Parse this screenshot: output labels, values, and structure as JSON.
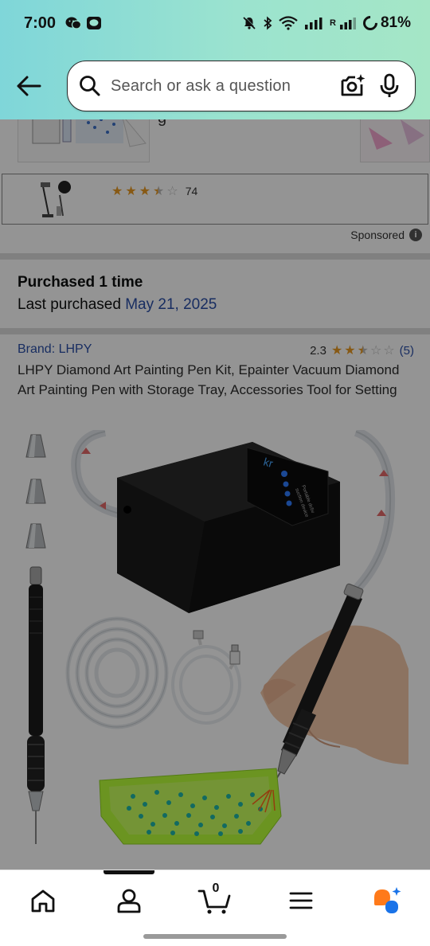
{
  "status_bar": {
    "time": "7:00",
    "battery": "81%",
    "signal_label": "R"
  },
  "search": {
    "placeholder": "Search or ask a question"
  },
  "sponsored_item": {
    "rating_count": "74",
    "stars": 3.5,
    "sponsored_label": "Sponsored"
  },
  "purchase_info": {
    "title": "Purchased 1 time",
    "last_purchased_label": "Last purchased ",
    "last_purchased_date": "May 21, 2025"
  },
  "product": {
    "brand": "Brand: LHPY",
    "rating": "2.3",
    "stars": 2.5,
    "review_count": "(5)",
    "title": "LHPY Diamond Art Painting Pen Kit, Epainter Vacuum Diamond Art Painting Pen with Storage Tray, Accessories Tool for Setting",
    "device_logo": "kr",
    "device_text_1": "Portable dc5v",
    "device_text_2": "suction device"
  },
  "bottom_nav": {
    "cart_count": "0",
    "items": [
      "home-icon",
      "account-icon",
      "cart-icon",
      "menu-icon",
      "rufus-ai-icon"
    ]
  },
  "colors": {
    "header_gradient_start": "#7fd6d9",
    "header_gradient_end": "#a5e6c6",
    "link_blue": "#2a4fa8",
    "star_orange": "#e89a24",
    "rufus_orange": "#ff7a1a",
    "rufus_blue": "#1a73e8"
  }
}
